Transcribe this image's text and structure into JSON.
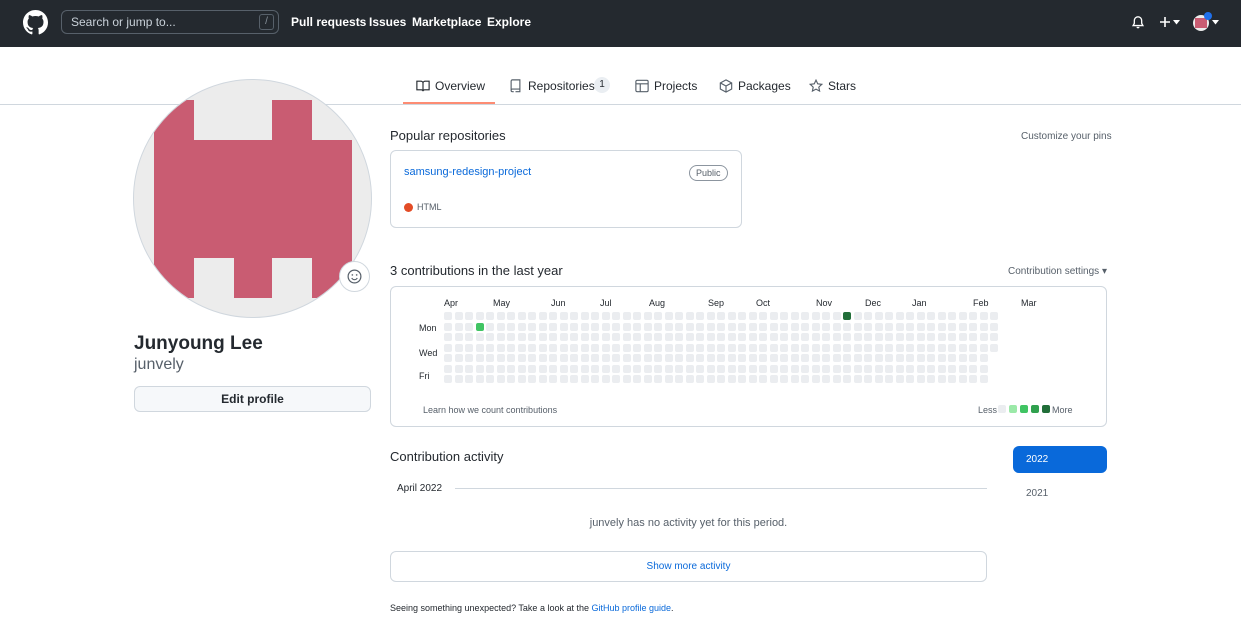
{
  "header": {
    "search_placeholder": "Search or jump to...",
    "search_shortcut": "/",
    "nav": [
      "Pull requests",
      "Issues",
      "Marketplace",
      "Explore"
    ],
    "icons": [
      "github-logo-icon",
      "bell-icon",
      "plus-icon",
      "caret-down-icon",
      "avatar"
    ]
  },
  "tabs": [
    {
      "label": "Overview",
      "icon": "book-icon",
      "active": true
    },
    {
      "label": "Repositories",
      "icon": "repo-icon",
      "count": "1"
    },
    {
      "label": "Projects",
      "icon": "table-icon"
    },
    {
      "label": "Packages",
      "icon": "package-icon"
    },
    {
      "label": "Stars",
      "icon": "star-icon"
    }
  ],
  "profile": {
    "full_name": "Junyoung Lee",
    "login": "junvely",
    "edit_label": "Edit profile",
    "avatar_color": "#c95c72"
  },
  "pinned": {
    "heading": "Popular repositories",
    "customize": "Customize your pins",
    "repos": [
      {
        "name": "samsung-redesign-project",
        "visibility": "Public",
        "language": "HTML",
        "language_color": "#e34c26"
      }
    ]
  },
  "contributions": {
    "heading": "3 contributions in the last year",
    "settings": "Contribution settings ▾",
    "months": [
      "Apr",
      "May",
      "Jun",
      "Jul",
      "Aug",
      "Sep",
      "Oct",
      "Nov",
      "Dec",
      "Jan",
      "Feb",
      "Mar"
    ],
    "days": [
      "Mon",
      "Wed",
      "Fri"
    ],
    "learn": "Learn how we count contributions",
    "less": "Less",
    "more": "More",
    "colors": [
      "#ebedf0",
      "#9be9a8",
      "#40c463",
      "#30a14e",
      "#216e39"
    ],
    "active_cells": [
      {
        "week": 3,
        "day": 1,
        "level": 2
      },
      {
        "week": 38,
        "day": 0,
        "level": 4
      }
    ]
  },
  "activity": {
    "heading": "Contribution activity",
    "month": "April 2022",
    "empty": "junvely has no activity yet for this period.",
    "show_more": "Show more activity",
    "footer_prefix": "Seeing something unexpected? Take a look at the ",
    "footer_link": "GitHub profile guide",
    "footer_suffix": ".",
    "years": [
      "2022",
      "2021"
    ]
  }
}
